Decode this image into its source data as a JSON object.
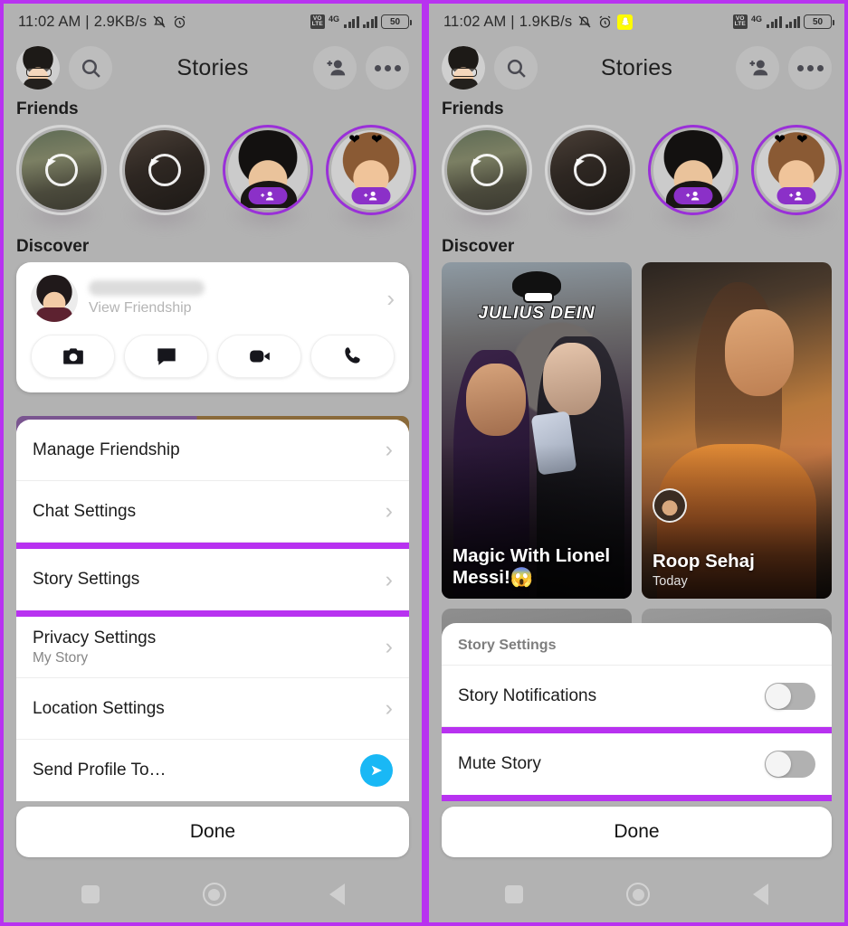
{
  "theme": {
    "highlight_color": "#b832f0",
    "accent_purple": "#8b30c8",
    "send_blue": "#19b8f5",
    "snap_yellow": "#fffc00",
    "background_gray": "#b2b2b2"
  },
  "left": {
    "status_bar": {
      "time": "11:02 AM",
      "separator": "|",
      "net_speed": "2.9KB/s",
      "silent_icon": "bell-mute-icon",
      "alarm_icon": "alarm-clock-icon",
      "volte_label": "VOLTE",
      "network_type": "4G",
      "battery_level": "50"
    },
    "header": {
      "avatar": "bitmoji-avatar",
      "search_icon": "search-icon",
      "title": "Stories",
      "add_friend_icon": "add-friend-icon",
      "more_icon": "more-options-icon"
    },
    "friends_section": {
      "title": "Friends"
    },
    "story_bubbles": [
      {
        "type": "replay",
        "badge": ""
      },
      {
        "type": "replay",
        "badge": ""
      },
      {
        "type": "bitmoji-dark-hair",
        "badge": "+"
      },
      {
        "type": "bitmoji-heart-headband",
        "badge": "+"
      }
    ],
    "discover_section": {
      "title": "Discover"
    },
    "friendship_card": {
      "name_redacted": "",
      "subtitle": "View Friendship",
      "chevron": "›",
      "actions": [
        "camera-icon",
        "chat-icon",
        "video-call-icon",
        "phone-call-icon"
      ]
    },
    "settings_sheet": {
      "rows": [
        {
          "label": "Manage Friendship",
          "sublabel": "",
          "trailing": "chevron",
          "highlighted": false
        },
        {
          "label": "Chat Settings",
          "sublabel": "",
          "trailing": "chevron",
          "highlighted": false
        },
        {
          "label": "Story Settings",
          "sublabel": "",
          "trailing": "chevron",
          "highlighted": true
        },
        {
          "label": "Privacy Settings",
          "sublabel": "My Story",
          "trailing": "chevron",
          "highlighted": false
        },
        {
          "label": "Location Settings",
          "sublabel": "",
          "trailing": "chevron",
          "highlighted": false
        },
        {
          "label": "Send Profile To…",
          "sublabel": "",
          "trailing": "send",
          "highlighted": false
        }
      ],
      "chevron": "›"
    },
    "done_label": "Done",
    "navbar": [
      "recents-square-icon",
      "home-circle-icon",
      "back-triangle-icon"
    ]
  },
  "right": {
    "status_bar": {
      "time": "11:02 AM",
      "separator": "|",
      "net_speed": "1.9KB/s",
      "silent_icon": "bell-mute-icon",
      "alarm_icon": "alarm-clock-icon",
      "snapchat_icon": "snapchat-notification-icon",
      "volte_label": "VOLTE",
      "network_type": "4G",
      "battery_level": "50"
    },
    "header": {
      "avatar": "bitmoji-avatar",
      "search_icon": "search-icon",
      "title": "Stories",
      "add_friend_icon": "add-friend-icon",
      "more_icon": "more-options-icon"
    },
    "friends_section": {
      "title": "Friends"
    },
    "story_bubbles": [
      {
        "type": "replay",
        "badge": ""
      },
      {
        "type": "replay",
        "badge": ""
      },
      {
        "type": "bitmoji-dark-hair",
        "badge": "+"
      },
      {
        "type": "bitmoji-heart-headband",
        "badge": "+"
      }
    ],
    "discover_section": {
      "title": "Discover"
    },
    "discover_cards": [
      {
        "title": "Magic With Lionel Messi!😱",
        "subtitle": "",
        "brand": "JULIUS DEIN",
        "has_avatar": false
      },
      {
        "title": "Roop Sehaj",
        "subtitle": "Today",
        "brand": "",
        "has_avatar": true
      }
    ],
    "story_settings_sheet": {
      "header": "Story Settings",
      "rows": [
        {
          "label": "Story Notifications",
          "toggle_on": false,
          "highlighted": false
        },
        {
          "label": "Mute Story",
          "toggle_on": false,
          "highlighted": true
        }
      ]
    },
    "done_label": "Done",
    "navbar": [
      "recents-square-icon",
      "home-circle-icon",
      "back-triangle-icon"
    ]
  }
}
